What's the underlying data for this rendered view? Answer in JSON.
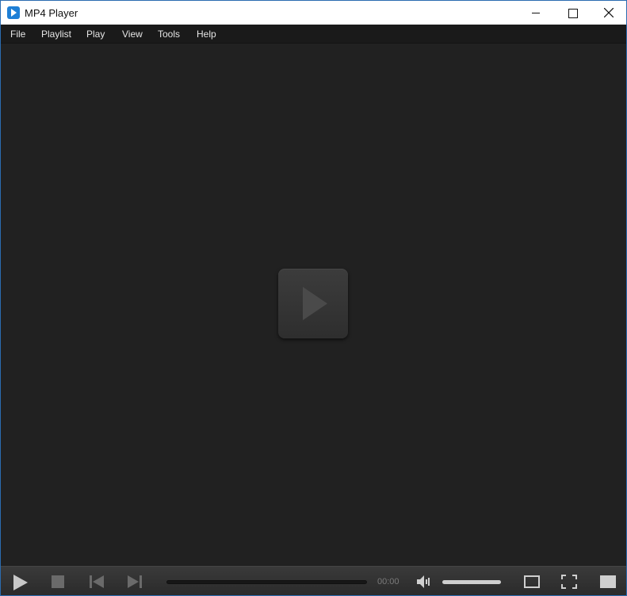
{
  "window": {
    "title": "MP4 Player"
  },
  "menu": {
    "items": [
      "File",
      "Playlist",
      "Play",
      "View",
      "Tools",
      "Help"
    ]
  },
  "player": {
    "center_icon": "big-play-icon",
    "progress": 0
  },
  "controls": {
    "time": "00:00",
    "volume_level": 1.0,
    "icons": [
      "play-icon",
      "stop-icon",
      "previous-icon",
      "next-icon",
      "volume-icon",
      "window-mode-icon",
      "fullscreen-icon",
      "panel-icon"
    ]
  },
  "colors": {
    "window_border": "#2b6cb0",
    "app_icon": "#1e7fd6",
    "video_background": "#212121"
  }
}
